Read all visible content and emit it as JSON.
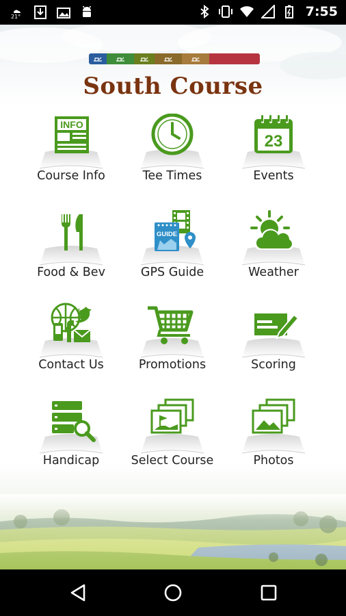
{
  "status_bar": {
    "time": "7:55",
    "temperature": "21°",
    "left_icons": [
      "weather-icon",
      "download-icon",
      "photo-icon",
      "android-icon"
    ],
    "right_icons": [
      "bluetooth-icon",
      "vibrate-icon",
      "wifi-icon",
      "signal-icon",
      "battery-icon"
    ]
  },
  "header": {
    "title": "South Course",
    "logo_colors": [
      "#2b5c9e",
      "#3f8d3a",
      "#6b7f1f",
      "#8a6a2a",
      "#a77b3c",
      "#b5343f"
    ]
  },
  "menu": [
    {
      "label": "Course Info",
      "icon": "info-icon"
    },
    {
      "label": "Tee Times",
      "icon": "clock-icon"
    },
    {
      "label": "Events",
      "icon": "calendar-icon",
      "calendar_day": "23"
    },
    {
      "label": "Food & Bev",
      "icon": "fork-knife-icon"
    },
    {
      "label": "GPS Guide",
      "icon": "gps-guide-icon",
      "badge": "GUIDE"
    },
    {
      "label": "Weather",
      "icon": "sun-cloud-icon"
    },
    {
      "label": "Contact Us",
      "icon": "contact-icon"
    },
    {
      "label": "Promotions",
      "icon": "cart-icon"
    },
    {
      "label": "Scoring",
      "icon": "scorecard-icon"
    },
    {
      "label": "Handicap",
      "icon": "handicap-icon"
    },
    {
      "label": "Select Course",
      "icon": "select-course-icon"
    },
    {
      "label": "Photos",
      "icon": "photos-icon"
    }
  ],
  "info_icon_text": "INFO",
  "colors": {
    "accent_green": "#4a9a1e",
    "title_brown": "#7a3410",
    "guide_blue": "#2f8fc8"
  },
  "nav": {
    "back": "back-icon",
    "home": "home-icon",
    "recents": "recents-icon"
  }
}
